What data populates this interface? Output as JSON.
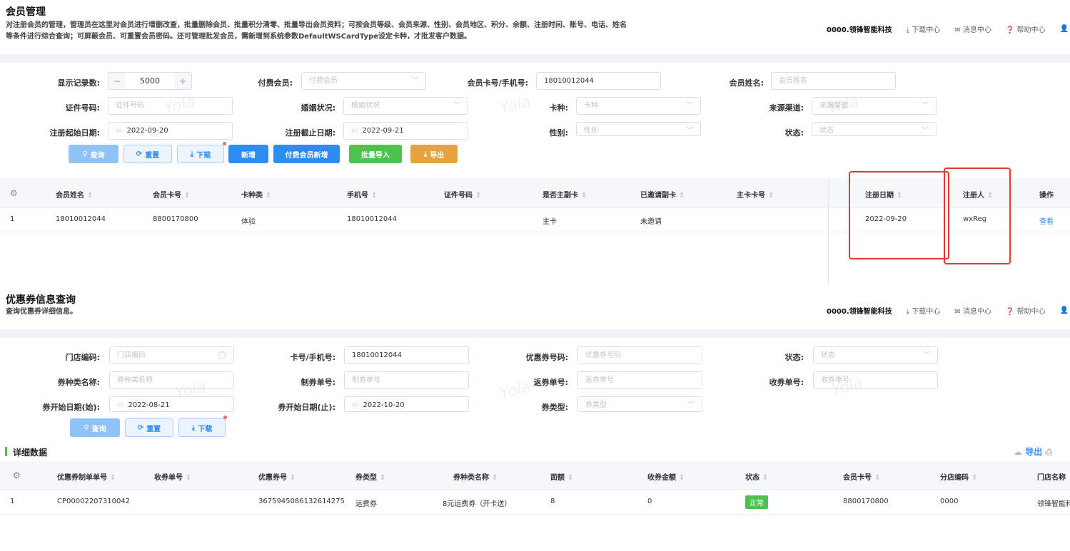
{
  "member": {
    "title": "会员管理",
    "desc1": "对注册会员的管理，管理员在这里对会员进行增删改查，批量删除会员、批量积分清零、批量导出会员资料；可按会员等级、会员来源、性别、会员地区、积分、余额、注册时间、账号、电话、姓名",
    "desc2": "等条件进行综合查询；可屏蔽会员、可重置会员密码。还可管理批发会员，需新增到系统参数DefaultWSCardType设定卡种，才批发客户数据。",
    "topbar": {
      "company": "0000.领锋智能科技",
      "download": "下载中心",
      "message": "消息中心",
      "help": "帮助中心"
    },
    "filters": {
      "display_count_label": "显示记录数:",
      "display_count_value": "5000",
      "paid_member_label": "付费会员:",
      "paid_member_ph": "付费会员",
      "card_phone_label": "会员卡号/手机号:",
      "card_phone_value": "18010012044",
      "member_name_label": "会员姓名:",
      "member_name_ph": "会员姓名",
      "id_no_label": "证件号码:",
      "id_no_ph": "证件号码",
      "marital_label": "婚姻状况:",
      "marital_ph": "婚姻状况",
      "card_type_label": "卡种:",
      "card_type_ph": "卡种",
      "channel_label": "来源渠道:",
      "channel_ph": "来源渠道",
      "reg_start_label": "注册起始日期:",
      "reg_start_value": "2022-09-20",
      "reg_end_label": "注册截止日期:",
      "reg_end_value": "2022-09-21",
      "gender_label": "性别:",
      "gender_ph": "性别",
      "status_label": "状态:",
      "status_ph": "状态"
    },
    "buttons": {
      "query": "查询",
      "reset": "重置",
      "download": "下载",
      "add": "新增",
      "paid_add": "付费会员新增",
      "import": "批量导入",
      "export": "导出"
    },
    "columns": [
      "会员姓名",
      "会员卡号",
      "卡种类",
      "手机号",
      "证件号码",
      "是否主副卡",
      "已邀请副卡",
      "主卡卡号",
      "注册日期",
      "注册人",
      "操作"
    ],
    "rows": [
      {
        "idx": "1",
        "name": "18010012044",
        "card": "8800170800",
        "type": "体验",
        "phone": "18010012044",
        "id_no": "",
        "main": "主卡",
        "invited": "未邀请",
        "main_card": "",
        "reg_date": "2022-09-20",
        "reg_by": "wxReg",
        "op": "查看"
      }
    ]
  },
  "coupon": {
    "title": "优惠券信息查询",
    "desc": "查询优惠券详细信息。",
    "topbar": {
      "company": "0000.领锋智能科技",
      "download": "下载中心",
      "message": "消息中心",
      "help": "帮助中心"
    },
    "filters": {
      "store_label": "门店编码:",
      "store_ph": "门店编码",
      "card_phone_label": "卡号/手机号:",
      "card_phone_value": "18010012044",
      "coupon_no_label": "优惠券号码:",
      "coupon_no_ph": "优惠券号码",
      "status_label": "状态:",
      "status_ph": "状态",
      "type_name_label": "券种类名称:",
      "type_name_ph": "券种类名称",
      "make_no_label": "制券单号:",
      "make_no_ph": "制券单号",
      "return_no_label": "返券单号:",
      "return_no_ph": "返券单号",
      "collect_no_label": "收券单号:",
      "collect_no_ph": "收券单号",
      "start_label": "券开始日期(始):",
      "start_value": "2022-08-21",
      "end_label": "券开始日期(止):",
      "end_value": "2022-10-20",
      "ctype_label": "券类型:",
      "ctype_ph": "券类型"
    },
    "buttons": {
      "query": "查询",
      "reset": "重置",
      "download": "下载",
      "export": "导出"
    },
    "section": "详细数据",
    "columns": [
      "优惠券制单单号",
      "收券单号",
      "优惠券号",
      "券类型",
      "券种类名称",
      "面额",
      "收券金额",
      "状态",
      "会员卡号",
      "分店编码",
      "门店名称"
    ],
    "rows": [
      {
        "idx": "1",
        "make_no": "CP00002207310042",
        "collect_no": "",
        "coupon_no": "3675945086132614275",
        "ctype": "运费券",
        "type_name": "8元运费券（开卡送）",
        "face": "8",
        "collect_amt": "0",
        "status": "正常",
        "card": "8800170800",
        "branch": "0000",
        "store": "领锋智能科"
      }
    ]
  },
  "watermark": "Yola"
}
